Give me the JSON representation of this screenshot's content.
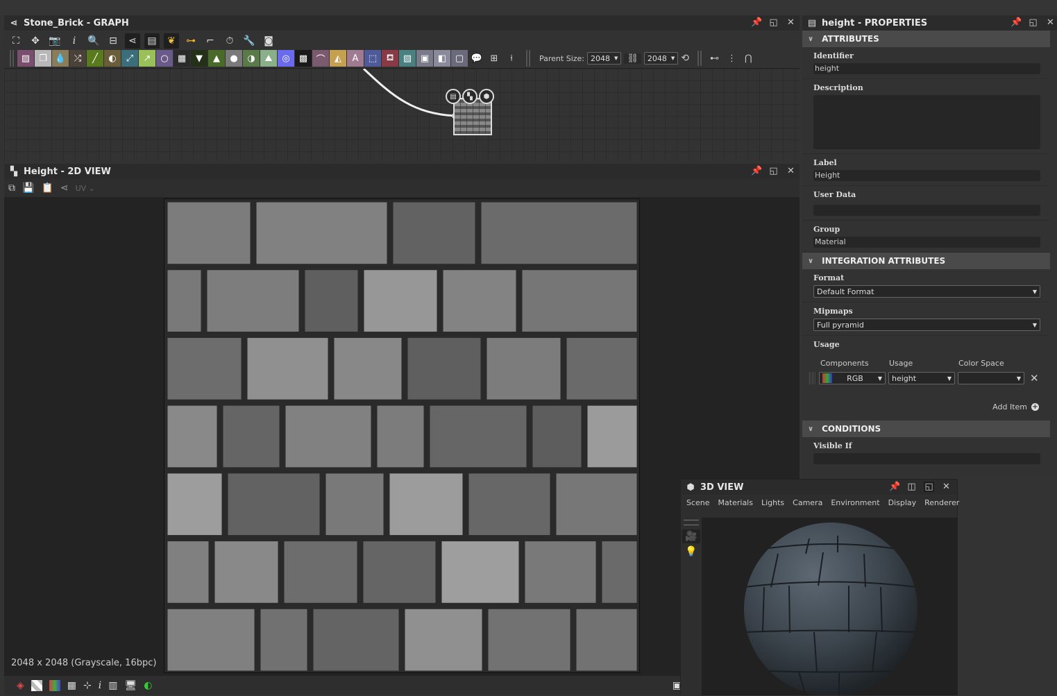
{
  "graph_panel": {
    "title": "Stone_Brick - GRAPH",
    "toolbar_icons": [
      "frame-all-icon",
      "fit-1to1-icon",
      "camera-icon",
      "info-icon",
      "search-icon",
      "connect-icon",
      "graph-share-icon",
      "layers-icon",
      "python-icon",
      "link-icon",
      "connector-icon",
      "timer-icon",
      "wrench-icon",
      "display-icon"
    ],
    "node_palette": [
      {
        "name": "bitmap-node",
        "glyph": "▨",
        "color": "#7a4e6e"
      },
      {
        "name": "svg-node",
        "glyph": "❐",
        "color": "#b8b8b8"
      },
      {
        "name": "uniform-color-node",
        "glyph": "💧",
        "color": "#8a7d5a"
      },
      {
        "name": "shuffle-node",
        "glyph": "⤮",
        "color": "#4a4238"
      },
      {
        "name": "curve-node",
        "glyph": "╱",
        "color": "#5a7a1e"
      },
      {
        "name": "colorize-node",
        "glyph": "◐",
        "color": "#6a5e3a"
      },
      {
        "name": "warp-node",
        "glyph": "⤢",
        "color": "#3a6e7a"
      },
      {
        "name": "gradient-node",
        "glyph": "↗",
        "color": "#9ac05a"
      },
      {
        "name": "shape-node",
        "glyph": "○",
        "color": "#6a5a8a"
      },
      {
        "name": "tile-node",
        "glyph": "▦",
        "color": "#2a2a2a"
      },
      {
        "name": "gradient-map-node",
        "glyph": "▼",
        "color": "#243018"
      },
      {
        "name": "levels-node",
        "glyph": "▲",
        "color": "#4a6a2a"
      },
      {
        "name": "blend-node",
        "glyph": "●",
        "color": "#7a7a7a"
      },
      {
        "name": "invert-node",
        "glyph": "◑",
        "color": "#5a7a4a"
      },
      {
        "name": "histogram-node",
        "glyph": "⛰",
        "color": "#8ab08a"
      },
      {
        "name": "hsl-node",
        "glyph": "◎",
        "color": "#6a6aee"
      },
      {
        "name": "noise-node",
        "glyph": "▩",
        "color": "#1a1a1a"
      },
      {
        "name": "spline-node",
        "glyph": "⌒",
        "color": "#7a5a6e"
      },
      {
        "name": "symmetry-node",
        "glyph": "◭",
        "color": "#c4a050"
      },
      {
        "name": "text-node",
        "glyph": "A",
        "color": "#a07a90"
      },
      {
        "name": "transform-node",
        "glyph": "⬚",
        "color": "#4e5a9a"
      },
      {
        "name": "fill-node",
        "glyph": "⛾",
        "color": "#8a3a44"
      },
      {
        "name": "pattern-node",
        "glyph": "▧",
        "color": "#4a8080"
      },
      {
        "name": "input-color-node",
        "glyph": "▣",
        "color": "#7a7a8a"
      },
      {
        "name": "input-gray-node",
        "glyph": "◧",
        "color": "#8a8a9a"
      },
      {
        "name": "output-node",
        "glyph": "▢",
        "color": "#6a6a7a"
      }
    ],
    "extra_icons": [
      "comment-icon",
      "frame-icon",
      "pin-icon"
    ],
    "parent_size_label": "Parent Size:",
    "parent_size_x": "2048",
    "parent_size_y": "2048",
    "node_icons": [
      "document-icon",
      "checker-icon",
      "cube-icon"
    ]
  },
  "view2d": {
    "title": "Height - 2D VIEW",
    "uv_label": "UV",
    "status": "2048 x 2048 (Grayscale, 16bpc)"
  },
  "properties": {
    "title": "height - PROPERTIES",
    "sections": {
      "attributes": "ATTRIBUTES",
      "integration": "INTEGRATION ATTRIBUTES",
      "conditions": "CONDITIONS"
    },
    "identifier_label": "Identifier",
    "identifier_value": "height",
    "description_label": "Description",
    "description_value": "",
    "label_label": "Label",
    "label_value": "Height",
    "user_data_label": "User Data",
    "user_data_value": "",
    "group_label": "Group",
    "group_value": "Material",
    "format_label": "Format",
    "format_value": "Default Format",
    "mipmaps_label": "Mipmaps",
    "mipmaps_value": "Full pyramid",
    "usage_label": "Usage",
    "usage_table": {
      "headers": [
        "Components",
        "Usage",
        "Color Space"
      ],
      "row": {
        "components": "RGB",
        "usage": "height",
        "color_space": ""
      }
    },
    "add_item": "Add Item",
    "visible_if_label": "Visible If",
    "visible_if_value": ""
  },
  "view3d": {
    "title": "3D VIEW",
    "menu": [
      "Scene",
      "Materials",
      "Lights",
      "Camera",
      "Environment",
      "Display",
      "Renderer"
    ]
  }
}
